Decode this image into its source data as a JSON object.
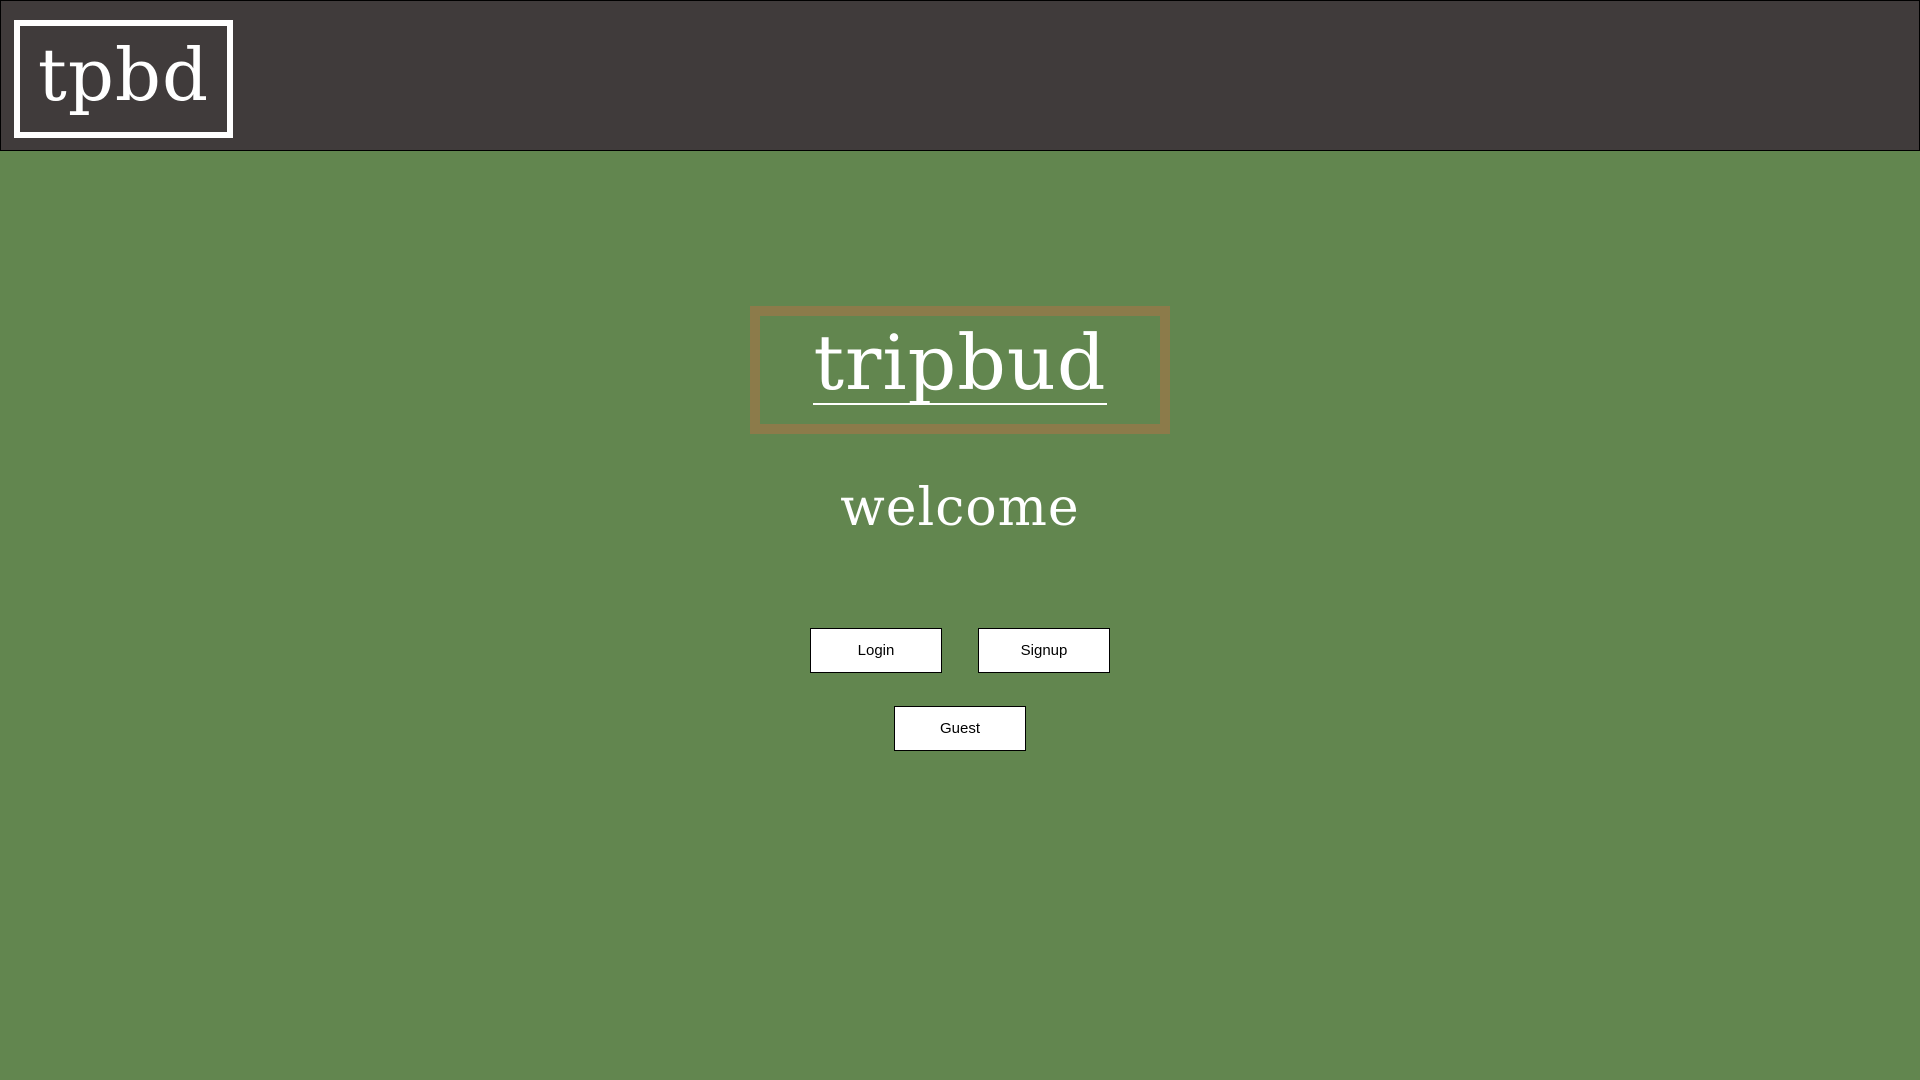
{
  "header": {
    "logo_text": "tpbd"
  },
  "hero": {
    "brand_title": "tripbud",
    "welcome_text": "welcome"
  },
  "actions": {
    "login_label": "Login",
    "signup_label": "Signup",
    "guest_label": "Guest"
  },
  "colors": {
    "header_background": "#403b3b",
    "page_background": "#62864f",
    "brand_border": "#8c7b4a",
    "text_light": "#ffffff",
    "button_background": "#ffffff"
  }
}
